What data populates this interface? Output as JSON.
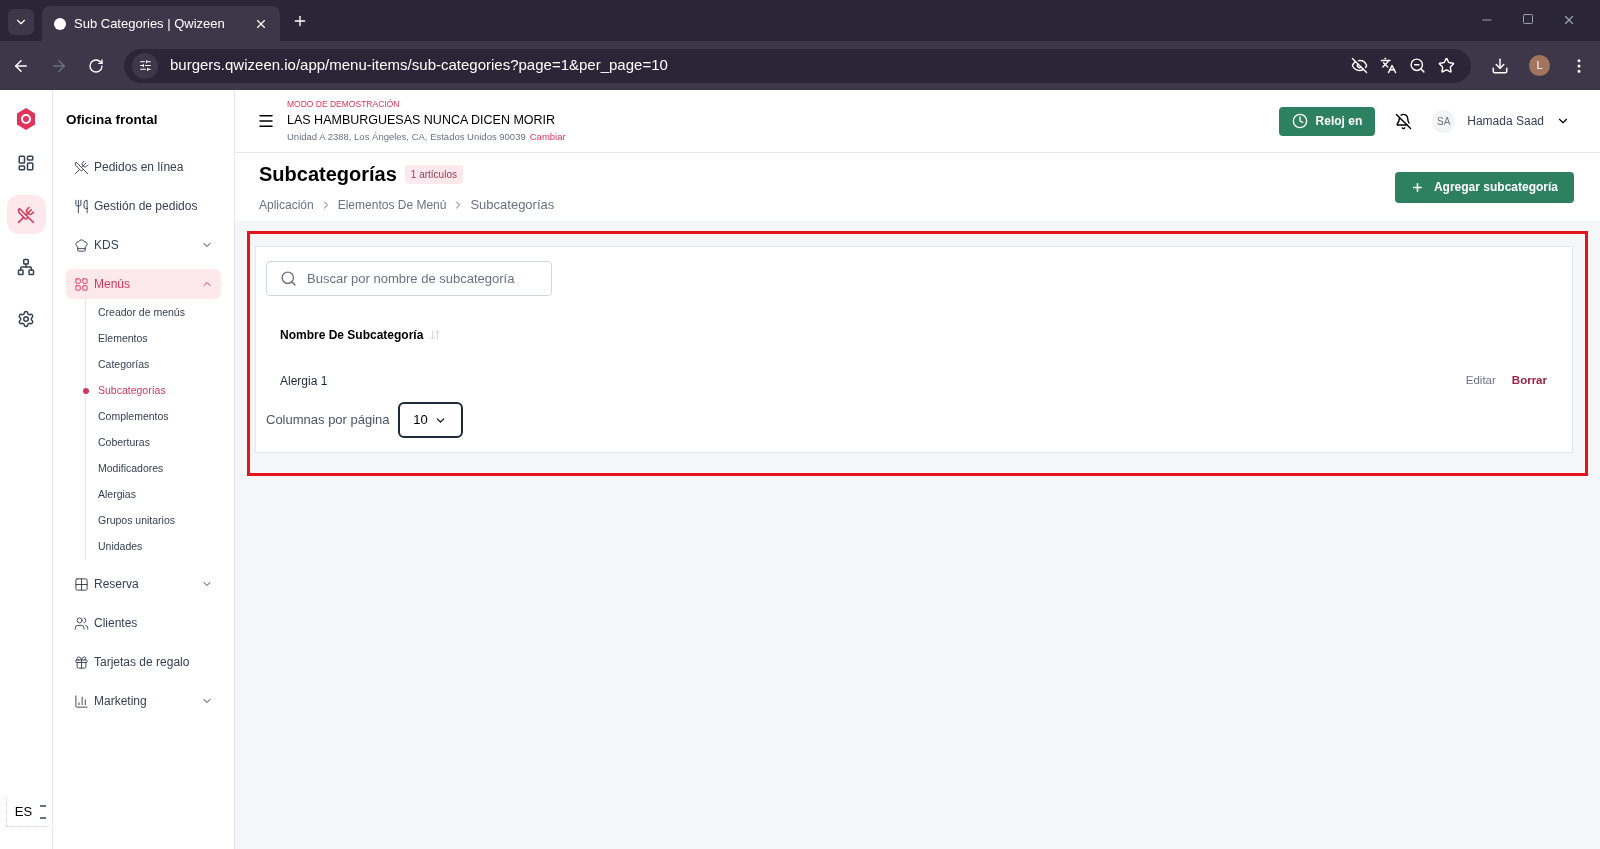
{
  "browser": {
    "tabs": [
      {
        "title": "Sub Categories | Qwizeen",
        "selected": true
      }
    ],
    "url": "burgers.qwizeen.io/app/menu-items/sub-categories?page=1&per_page=10",
    "profile_initial": "L"
  },
  "rail": [
    {
      "kind": "dashboard",
      "selected": false
    },
    {
      "kind": "menu",
      "selected": true
    },
    {
      "kind": "org",
      "selected": false
    },
    {
      "kind": "settings",
      "selected": false
    }
  ],
  "language": "ES",
  "sidebar": {
    "title": "Oficina frontal",
    "items": [
      {
        "label": "Pedidos en línea",
        "kind": "link",
        "selected": false
      },
      {
        "label": "Gestión de pedidos",
        "kind": "link",
        "selected": false
      },
      {
        "label": "KDS",
        "kind": "group",
        "selected": false,
        "expanded": false
      },
      {
        "label": "Menús",
        "kind": "group",
        "selected": true,
        "expanded": true,
        "children": [
          {
            "label": "Creador de menús",
            "selected": false
          },
          {
            "label": "Elementos",
            "selected": false
          },
          {
            "label": "Categorías",
            "selected": false
          },
          {
            "label": "Subcategorías",
            "selected": true
          },
          {
            "label": "Complementos",
            "selected": false
          },
          {
            "label": "Coberturas",
            "selected": false
          },
          {
            "label": "Modificadores",
            "selected": false
          },
          {
            "label": "Alergias",
            "selected": false
          },
          {
            "label": "Grupos unitarios",
            "selected": false
          },
          {
            "label": "Unidades",
            "selected": false
          }
        ]
      },
      {
        "label": "Reserva",
        "kind": "group",
        "selected": false,
        "expanded": false
      },
      {
        "label": "Clientes",
        "kind": "link",
        "selected": false
      },
      {
        "label": "Tarjetas de regalo",
        "kind": "link",
        "selected": false
      },
      {
        "label": "Marketing",
        "kind": "group",
        "selected": false,
        "expanded": false
      }
    ]
  },
  "header": {
    "demo_label": "MODO DE DEMOSTRACIÓN",
    "store_name": "LAS HAMBURGUESAS NUNCA DICEN MORIR",
    "address": "Unidad A 2388, Los Ángeles, CA, Estados Unidos 90039",
    "change_link": "Cambiar",
    "clock_button": "Reloj en",
    "user": {
      "initials": "SA",
      "name": "Hamada Saad"
    }
  },
  "page": {
    "title": "Subcategorías",
    "count_badge": "1 artículos",
    "breadcrumbs": [
      "Aplicación",
      "Elementos De Menú",
      "Subcategorías"
    ],
    "add_button": "Agregar subcategoría"
  },
  "table": {
    "search_placeholder": "Buscar por nombre de subcategoría",
    "columns": [
      {
        "label": "Nombre De Subcategoría",
        "sortable": true
      }
    ],
    "rows": [
      {
        "cells": [
          "Alergia 1"
        ],
        "actions": [
          {
            "label": "Editar",
            "kind": "edit"
          },
          {
            "label": "Borrar",
            "kind": "delete"
          }
        ]
      }
    ],
    "rows_per_page_label": "Columnas por página",
    "rows_per_page": "10"
  }
}
